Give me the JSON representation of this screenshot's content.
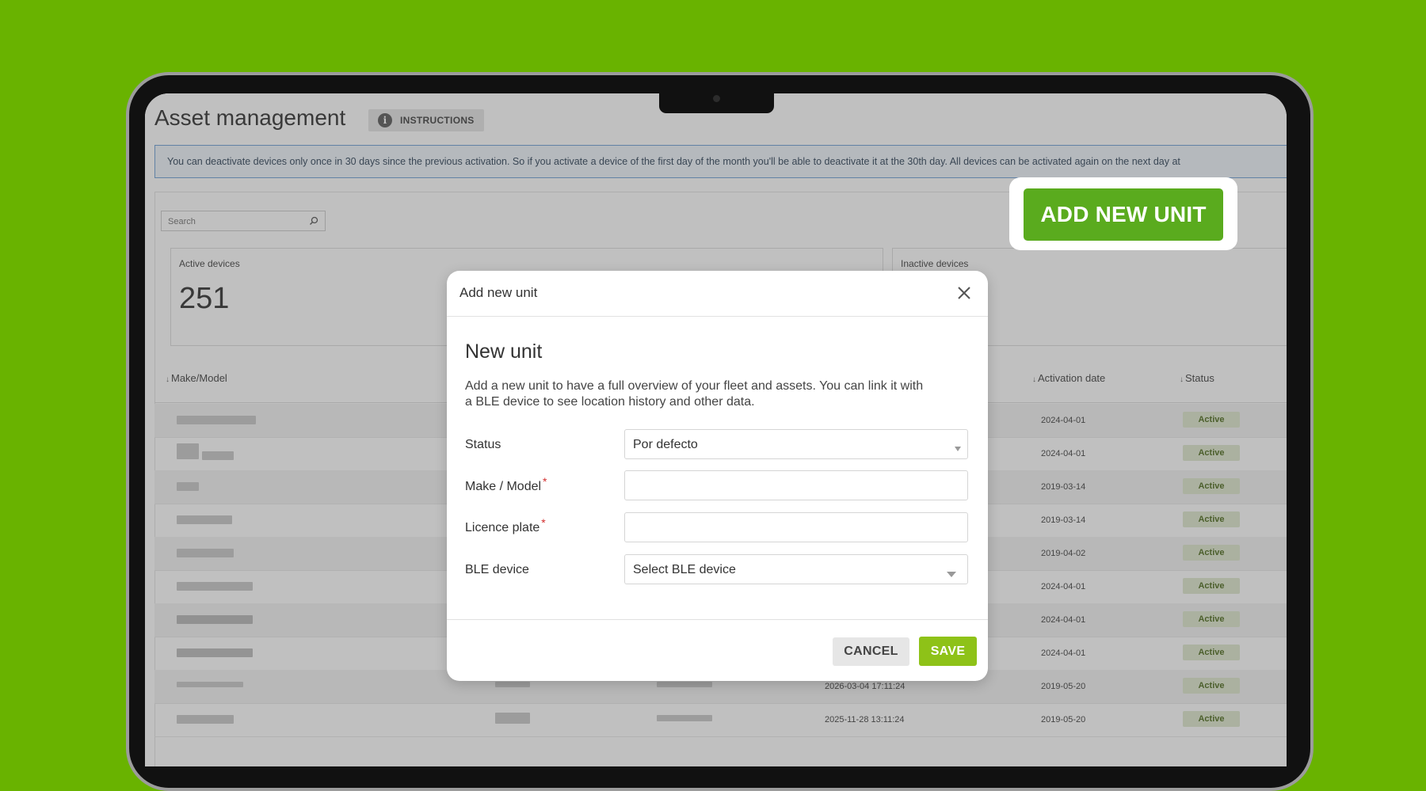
{
  "page": {
    "title": "Asset management",
    "instructions_label": "INSTRUCTIONS",
    "notice": "You can deactivate devices only once in 30 days since the previous activation. So if you activate a device of the first day of the month you'll be able to deactivate it at the 30th day. All devices can be activated again on the next day at"
  },
  "search": {
    "placeholder": "Search"
  },
  "stats": {
    "active_label": "Active devices",
    "active_value": "251",
    "inactive_label": "Inactive devices"
  },
  "table": {
    "headers": {
      "make_model": "Make/Model",
      "activation_date": "Activation date",
      "status": "Status"
    },
    "rows": [
      {
        "activation_date": "2024-04-01",
        "status": "Active"
      },
      {
        "activation_date": "2024-04-01",
        "status": "Active"
      },
      {
        "activation_date": "2019-03-14",
        "status": "Active"
      },
      {
        "activation_date": "2019-03-14",
        "status": "Active"
      },
      {
        "activation_date": "2019-04-02",
        "status": "Active"
      },
      {
        "activation_date": "2024-04-01",
        "status": "Active"
      },
      {
        "activation_date": "2024-04-01",
        "status": "Active"
      },
      {
        "activation_date": "2024-04-01",
        "status": "Active"
      },
      {
        "last_seen": "2026-03-04 17:11:24",
        "activation_date": "2019-05-20",
        "status": "Active"
      },
      {
        "last_seen": "2025-11-28 13:11:24",
        "activation_date": "2019-05-20",
        "status": "Active"
      }
    ]
  },
  "add_new_unit_label": "ADD NEW UNIT",
  "modal": {
    "header_title": "Add new unit",
    "heading": "New unit",
    "description_line1": "Add a new unit to have a full overview of your fleet and assets. You can link it with",
    "description_line2": "a BLE device to see location history and other data.",
    "status_label": "Status",
    "status_value": "Por defecto",
    "make_model_label": "Make / Model",
    "make_model_value": "",
    "licence_plate_label": "Licence plate",
    "licence_plate_value": "",
    "required_mark": "*",
    "ble_label": "BLE device",
    "ble_value": "Select BLE device",
    "cancel_label": "CANCEL",
    "save_label": "SAVE"
  },
  "colors": {
    "background": "#69b300",
    "add_button": "#5aab1e",
    "save_button": "#8ec218",
    "active_badge_bg": "#dfe9cf",
    "alert_border": "#6fa1d6"
  }
}
